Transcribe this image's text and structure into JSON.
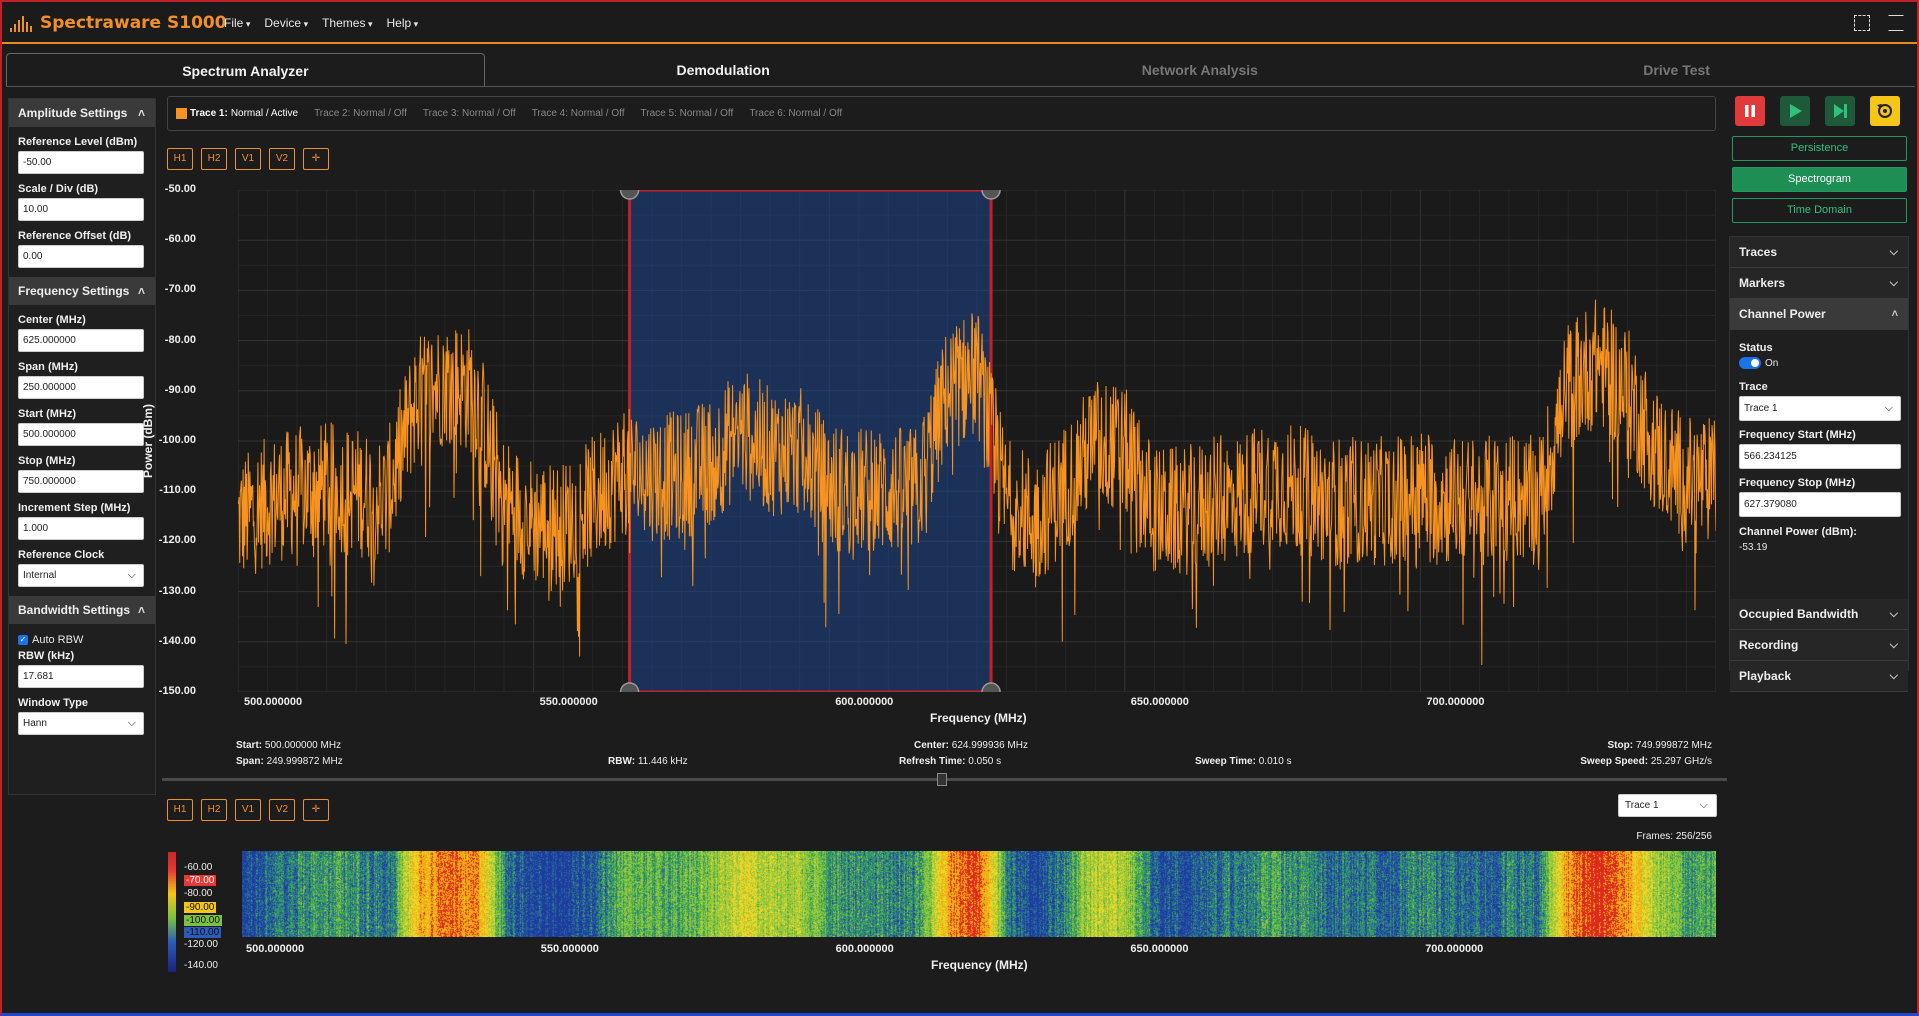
{
  "app": {
    "title": "Spectraware S1000"
  },
  "menu": [
    {
      "label": "File"
    },
    {
      "label": "Device"
    },
    {
      "label": "Themes"
    },
    {
      "label": "Help"
    }
  ],
  "tabs": [
    {
      "label": "Spectrum Analyzer",
      "state": "active"
    },
    {
      "label": "Demodulation",
      "state": "enabled"
    },
    {
      "label": "Network Analysis",
      "state": "disabled"
    },
    {
      "label": "Drive Test",
      "state": "disabled"
    }
  ],
  "amplitude": {
    "title": "Amplitude Settings",
    "ref_level_label": "Reference Level (dBm)",
    "ref_level": "-50.00",
    "scale_label": "Scale / Div (dB)",
    "scale": "10.00",
    "offset_label": "Reference Offset (dB)",
    "offset": "0.00"
  },
  "frequency": {
    "title": "Frequency Settings",
    "center_label": "Center (MHz)",
    "center": "625.000000",
    "span_label": "Span (MHz)",
    "span": "250.000000",
    "start_label": "Start (MHz)",
    "start": "500.000000",
    "stop_label": "Stop (MHz)",
    "stop": "750.000000",
    "step_label": "Increment Step (MHz)",
    "step": "1.000",
    "clock_label": "Reference Clock",
    "clock": "Internal"
  },
  "bandwidth": {
    "title": "Bandwidth Settings",
    "auto_rbw_label": "Auto RBW",
    "rbw_label": "RBW (kHz)",
    "rbw": "17.681",
    "window_label": "Window Type",
    "window": "Hann"
  },
  "traces": [
    {
      "name": "Trace 1:",
      "status": "Normal / Active",
      "active": true
    },
    {
      "name": "Trace 2:",
      "status": "Normal / Off",
      "active": false
    },
    {
      "name": "Trace 3:",
      "status": "Normal / Off",
      "active": false
    },
    {
      "name": "Trace 4:",
      "status": "Normal / Off",
      "active": false
    },
    {
      "name": "Trace 5:",
      "status": "Normal / Off",
      "active": false
    },
    {
      "name": "Trace 6:",
      "status": "Normal / Off",
      "active": false
    }
  ],
  "marker_buttons": [
    "H1",
    "H2",
    "V1",
    "V2"
  ],
  "modes": {
    "persistence": "Persistence",
    "spectrogram": "Spectrogram",
    "time_domain": "Time Domain"
  },
  "right": {
    "traces": "Traces",
    "markers": "Markers",
    "channel_power": "Channel Power",
    "status_label": "Status",
    "status_value": "On",
    "trace_label": "Trace",
    "trace_value": "Trace 1",
    "fstart_label": "Frequency Start (MHz)",
    "fstart": "566.234125",
    "fstop_label": "Frequency Stop (MHz)",
    "fstop": "627.379080",
    "cp_label": "Channel Power (dBm):",
    "cp_value": "-53.19",
    "occupied": "Occupied Bandwidth",
    "recording": "Recording",
    "playback": "Playback"
  },
  "stats": {
    "start_label": "Start:",
    "start": "500.000000 MHz",
    "span_label": "Span:",
    "span": "249.999872 MHz",
    "rbw_label": "RBW:",
    "rbw": "11.446 kHz",
    "center_label": "Center:",
    "center": "624.999936 MHz",
    "refresh_label": "Refresh Time:",
    "refresh": "0.050 s",
    "sweep_label": "Sweep Time:",
    "sweep": "0.010 s",
    "stop_label": "Stop:",
    "stop": "749.999872 MHz",
    "speed_label": "Sweep Speed:",
    "speed": "25.297 GHz/s"
  },
  "spectrogram": {
    "trace_select": "Trace 1",
    "frames": "Frames: 256/256",
    "colorbar_ticks": [
      "-60.00",
      "-70.00",
      "-80.00",
      "-90.00",
      "-100.00",
      "-110.00",
      "-120.00",
      "-140.00"
    ],
    "xlabel": "Frequency (MHz)"
  },
  "chart_data": {
    "type": "line",
    "xlabel": "Frequency (MHz)",
    "ylabel": "Power (dBm)",
    "xlim": [
      500,
      750
    ],
    "ylim": [
      -150,
      -50
    ],
    "x_ticks": [
      "500.000000",
      "550.000000",
      "600.000000",
      "650.000000",
      "700.000000"
    ],
    "y_ticks": [
      "-50.00",
      "-60.00",
      "-70.00",
      "-80.00",
      "-90.00",
      "-100.00",
      "-110.00",
      "-120.00",
      "-130.00",
      "-140.00",
      "-150.00"
    ],
    "channel_power_region": [
      566.234125,
      627.37908
    ],
    "series": [
      {
        "x": [
          500,
          505,
          510,
          515,
          520,
          525,
          530,
          535,
          540,
          545,
          550,
          555,
          560,
          565,
          570,
          575,
          580,
          585,
          590,
          595,
          600,
          605,
          610,
          615,
          620,
          625,
          630,
          635,
          640,
          645,
          650,
          655,
          660,
          665,
          670,
          675,
          680,
          685,
          690,
          695,
          700,
          705,
          710,
          715,
          720,
          725,
          730,
          735,
          740,
          745,
          750
        ],
        "values": [
          -112,
          -108,
          -106,
          -105,
          -106,
          -108,
          -88,
          -84,
          -86,
          -108,
          -112,
          -113,
          -108,
          -102,
          -103,
          -103,
          -100,
          -94,
          -98,
          -98,
          -105,
          -106,
          -106,
          -106,
          -86,
          -82,
          -108,
          -112,
          -105,
          -96,
          -98,
          -110,
          -110,
          -108,
          -107,
          -104,
          -106,
          -108,
          -108,
          -108,
          -106,
          -108,
          -108,
          -107,
          -108,
          -85,
          -80,
          -86,
          -98,
          -104,
          -104
        ]
      }
    ]
  },
  "colors": {
    "accent": "#f0902a",
    "trace": "#f7931e",
    "green": "#1e8e55",
    "red": "#e03a3a",
    "yellow": "#f5c518"
  }
}
